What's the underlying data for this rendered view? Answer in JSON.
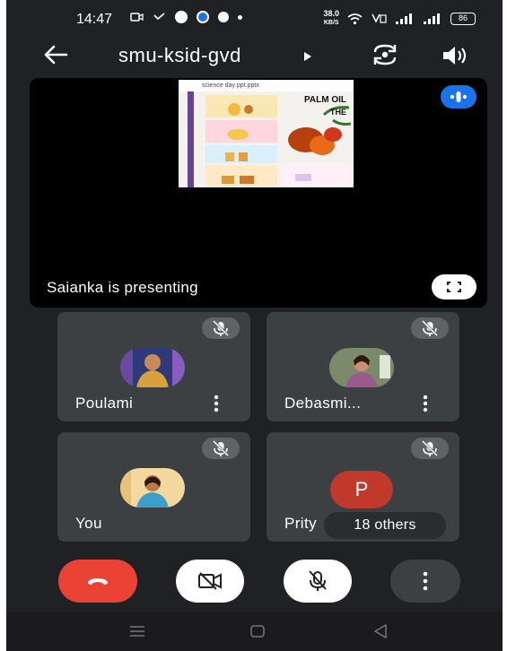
{
  "status_bar": {
    "time": "14:47",
    "network_speed_value": "38.0",
    "network_speed_unit": "KB/S",
    "battery": "86"
  },
  "top_bar": {
    "meeting_code": "smu-ksid-gvd"
  },
  "presentation": {
    "shared_title": "science day ppt.pptx",
    "slide_heading": "PALM OIL",
    "slide_subheading": "THE",
    "presenter_text": "Saianka is presenting"
  },
  "participants": [
    {
      "name": "Poulami"
    },
    {
      "name": "Debasmi..."
    },
    {
      "name": "You"
    },
    {
      "name": "Prity",
      "initial": "P",
      "others_label": "18 others"
    }
  ],
  "colors": {
    "background": "#202124",
    "tile": "#3c4043",
    "end_call": "#ea4335",
    "accent_blue": "#1a73e8",
    "avatar_red": "#c0392b"
  }
}
